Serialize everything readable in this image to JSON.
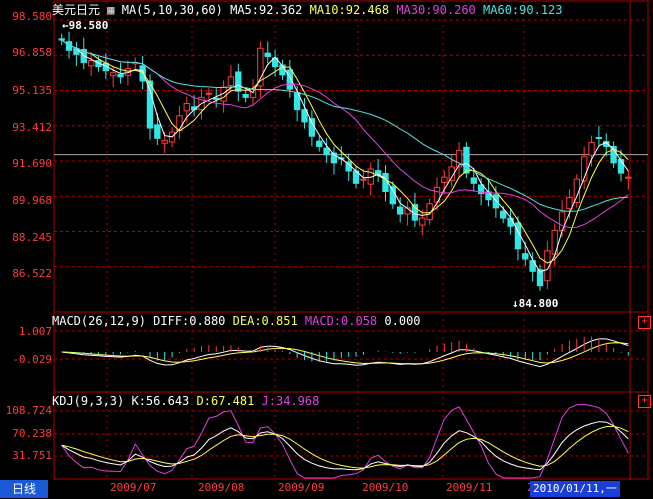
{
  "header": {
    "symbol": "美元日元",
    "ma_params": "MA(5,10,30,60)",
    "ma5": "MA5:92.362",
    "ma10": "MA10:92.468",
    "ma30": "MA30:90.260",
    "ma60": "MA60:90.123"
  },
  "price_panel": {
    "y_labels": [
      "98.580",
      "96.858",
      "95.135",
      "93.412",
      "91.690",
      "89.968",
      "88.245",
      "86.522"
    ],
    "high_label": "98.580",
    "low_label": "84.800"
  },
  "macd_panel": {
    "title": "MACD(26,12,9)",
    "diff": "DIFF:0.880",
    "dea": "DEA:0.851",
    "macd": "MACD:0.058",
    "extra": "0.000",
    "y_labels": [
      "1.007",
      "-0.029"
    ],
    "plus": "+"
  },
  "kdj_panel": {
    "title": "KDJ(9,3,3)",
    "k": "K:56.643",
    "d": "D:67.481",
    "j": "J:34.968",
    "y_labels": [
      "108.724",
      "70.238",
      "31.751"
    ],
    "plus": "+"
  },
  "x_axis": {
    "labels": [
      "2009/07",
      "2009/08",
      "2009/09",
      "2009/10",
      "2009/11",
      "20"
    ]
  },
  "footer": {
    "tab_label": "日线",
    "date_readout": "2010/01/11,一"
  },
  "colors": {
    "up": "#ff3b3b",
    "down": "#33e6e6",
    "ma5": "#ffffff",
    "ma10": "#ffff55",
    "ma30": "#e040e0",
    "ma60": "#55e0e0",
    "grid": "#b00000"
  },
  "chart_data": {
    "type": "candlestick",
    "ylim": [
      84.8,
      98.58
    ],
    "points_approx_close": [
      97.6,
      97.1,
      96.9,
      96.5,
      96.6,
      96.3,
      96.1,
      96.0,
      95.8,
      96.2,
      96.5,
      95.6,
      93.3,
      92.8,
      92.7,
      93.1,
      93.9,
      94.5,
      94.2,
      94.8,
      95.0,
      94.7,
      95.3,
      95.8,
      95.1,
      94.8,
      95.2,
      97.2,
      96.8,
      96.3,
      95.9,
      95.2,
      94.2,
      93.6,
      92.9,
      92.4,
      92.0,
      91.6,
      91.8,
      91.2,
      90.6,
      90.8,
      91.3,
      91.0,
      90.2,
      89.6,
      89.1,
      89.4,
      88.8,
      88.9,
      89.6,
      90.4,
      90.9,
      91.4,
      92.2,
      91.1,
      90.6,
      90.1,
      89.8,
      89.4,
      88.9,
      88.5,
      87.4,
      86.9,
      86.3,
      85.6,
      87.3,
      88.3,
      89.2,
      89.9,
      90.8,
      91.9,
      92.6,
      92.8,
      92.4,
      91.6,
      91.1,
      90.9
    ]
  }
}
